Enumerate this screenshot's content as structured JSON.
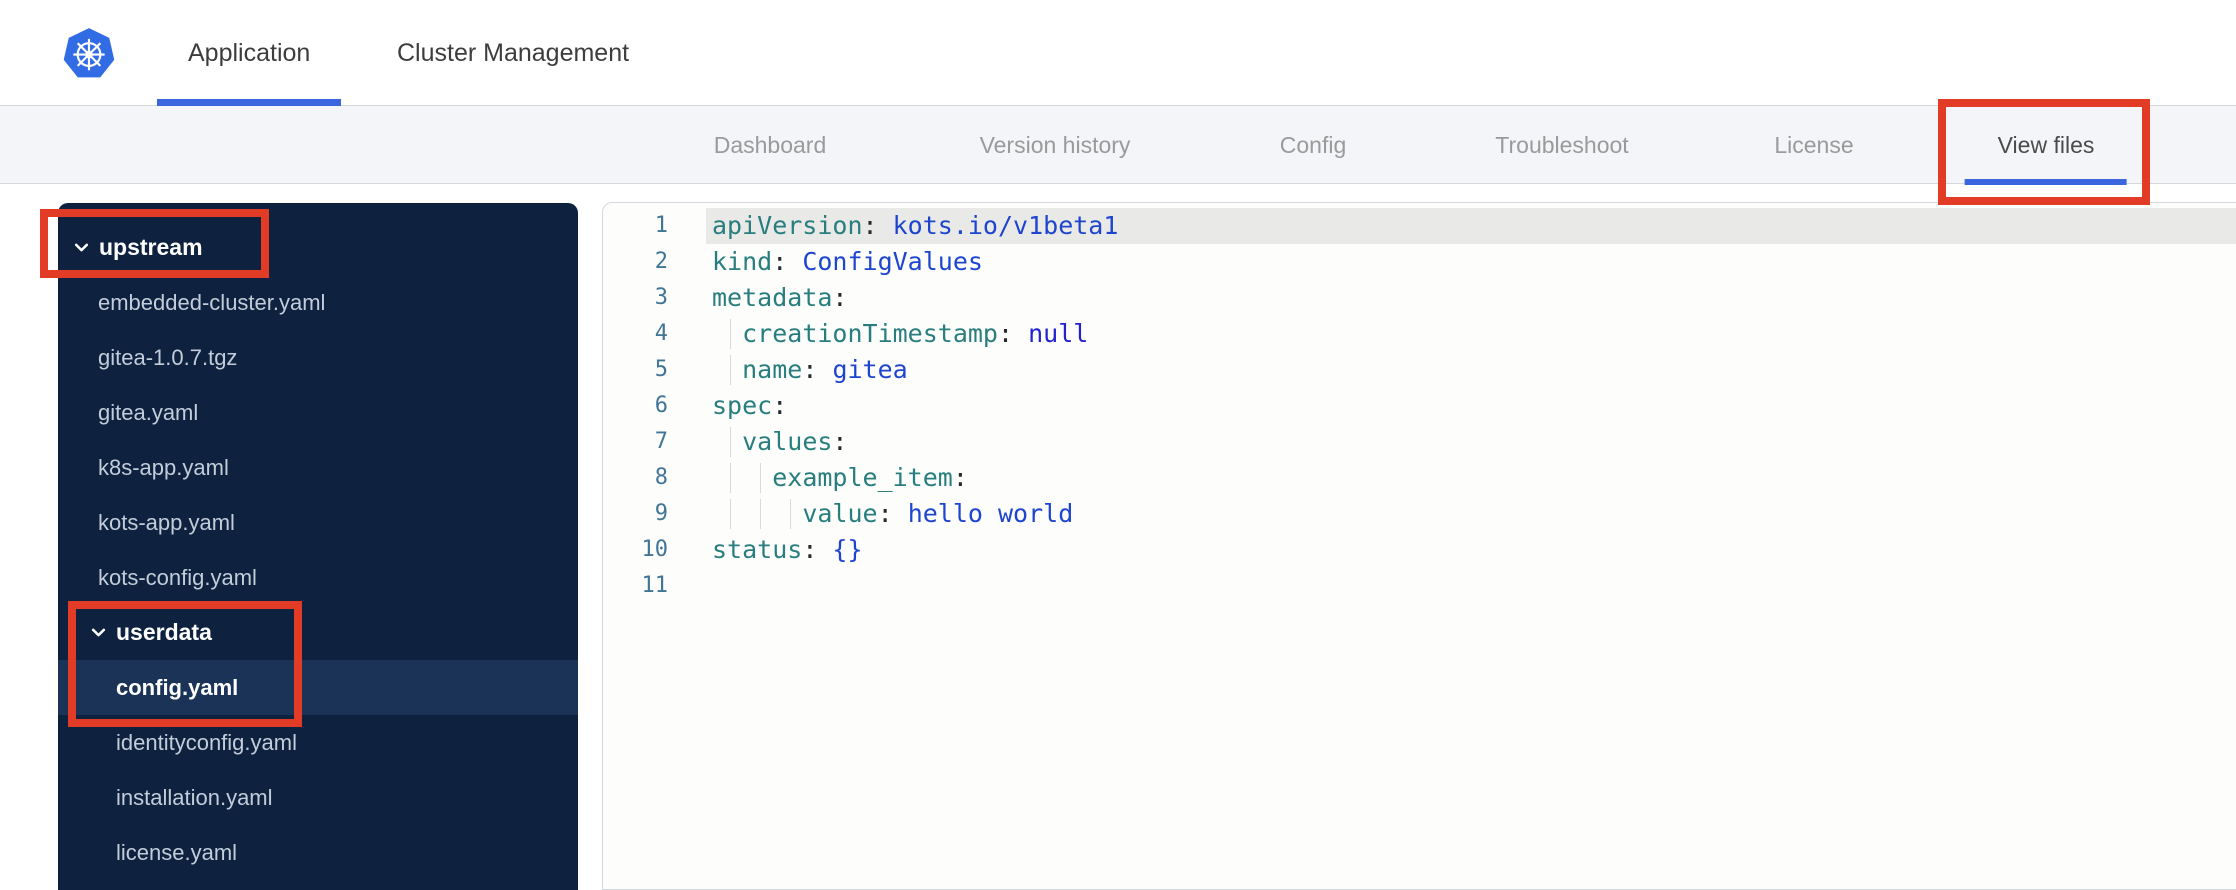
{
  "header": {
    "logo": "kubernetes-logo",
    "tabs": [
      {
        "label": "Application",
        "active": true
      },
      {
        "label": "Cluster Management",
        "active": false
      }
    ]
  },
  "subnav": {
    "items": [
      {
        "label": "Dashboard",
        "active": false
      },
      {
        "label": "Version history",
        "active": false
      },
      {
        "label": "Config",
        "active": false
      },
      {
        "label": "Troubleshoot",
        "active": false
      },
      {
        "label": "License",
        "active": false
      },
      {
        "label": "View files",
        "active": true
      }
    ]
  },
  "file_tree": {
    "items": [
      {
        "label": "upstream",
        "type": "folder",
        "level": 0,
        "expanded": true,
        "selected": false
      },
      {
        "label": "embedded-cluster.yaml",
        "type": "file",
        "level": 1,
        "selected": false
      },
      {
        "label": "gitea-1.0.7.tgz",
        "type": "file",
        "level": 1,
        "selected": false
      },
      {
        "label": "gitea.yaml",
        "type": "file",
        "level": 1,
        "selected": false
      },
      {
        "label": "k8s-app.yaml",
        "type": "file",
        "level": 1,
        "selected": false
      },
      {
        "label": "kots-app.yaml",
        "type": "file",
        "level": 1,
        "selected": false
      },
      {
        "label": "kots-config.yaml",
        "type": "file",
        "level": 1,
        "selected": false
      },
      {
        "label": "userdata",
        "type": "folder",
        "level": 1,
        "expanded": true,
        "selected": false
      },
      {
        "label": "config.yaml",
        "type": "file",
        "level": 2,
        "selected": true
      },
      {
        "label": "identityconfig.yaml",
        "type": "file",
        "level": 2,
        "selected": false
      },
      {
        "label": "installation.yaml",
        "type": "file",
        "level": 2,
        "selected": false
      },
      {
        "label": "license.yaml",
        "type": "file",
        "level": 2,
        "selected": false
      }
    ]
  },
  "editor": {
    "language": "yaml",
    "lines": [
      {
        "n": "1",
        "active": true,
        "guides": 0,
        "tokens": [
          [
            "key",
            "apiVersion"
          ],
          [
            "punct",
            ": "
          ],
          [
            "val",
            "kots.io/v1beta1"
          ]
        ]
      },
      {
        "n": "2",
        "active": false,
        "guides": 0,
        "tokens": [
          [
            "key",
            "kind"
          ],
          [
            "punct",
            ": "
          ],
          [
            "val",
            "ConfigValues"
          ]
        ]
      },
      {
        "n": "3",
        "active": false,
        "guides": 0,
        "tokens": [
          [
            "key",
            "metadata"
          ],
          [
            "punct",
            ":"
          ]
        ]
      },
      {
        "n": "4",
        "active": false,
        "guides": 1,
        "tokens": [
          [
            "sp",
            "  "
          ],
          [
            "key",
            "creationTimestamp"
          ],
          [
            "punct",
            ": "
          ],
          [
            "null",
            "null"
          ]
        ]
      },
      {
        "n": "5",
        "active": false,
        "guides": 1,
        "tokens": [
          [
            "sp",
            "  "
          ],
          [
            "key",
            "name"
          ],
          [
            "punct",
            ": "
          ],
          [
            "val",
            "gitea"
          ]
        ]
      },
      {
        "n": "6",
        "active": false,
        "guides": 0,
        "tokens": [
          [
            "key",
            "spec"
          ],
          [
            "punct",
            ":"
          ]
        ]
      },
      {
        "n": "7",
        "active": false,
        "guides": 1,
        "tokens": [
          [
            "sp",
            "  "
          ],
          [
            "key",
            "values"
          ],
          [
            "punct",
            ":"
          ]
        ]
      },
      {
        "n": "8",
        "active": false,
        "guides": 2,
        "tokens": [
          [
            "sp",
            "    "
          ],
          [
            "key",
            "example_item"
          ],
          [
            "punct",
            ":"
          ]
        ]
      },
      {
        "n": "9",
        "active": false,
        "guides": 3,
        "tokens": [
          [
            "sp",
            "      "
          ],
          [
            "key",
            "value"
          ],
          [
            "punct",
            ": "
          ],
          [
            "val",
            "hello world"
          ]
        ]
      },
      {
        "n": "10",
        "active": false,
        "guides": 0,
        "tokens": [
          [
            "key",
            "status"
          ],
          [
            "punct",
            ": "
          ],
          [
            "val",
            "{}"
          ]
        ]
      },
      {
        "n": "11",
        "active": false,
        "guides": 0,
        "tokens": []
      }
    ]
  },
  "annotations": {
    "boxes": [
      "upstream-folder",
      "userdata-config",
      "view-files-tab"
    ],
    "color": "#e23b26"
  },
  "colors": {
    "sidebar_bg": "#0e2240",
    "sidebar_selected": "#1a3356",
    "accent_blue": "#3a66e0",
    "annotation_red": "#e23b26",
    "key_teal": "#287e7e",
    "value_blue": "#1e45cf"
  },
  "layout_hints": {
    "header_tab_lefts": [
      188,
      397
    ],
    "nav_item_centers": [
      770,
      1055,
      1313,
      1562,
      1814,
      2046
    ],
    "tree_indent_folder": [
      15,
      32
    ],
    "tree_indent_file": [
      40,
      40,
      58
    ]
  }
}
